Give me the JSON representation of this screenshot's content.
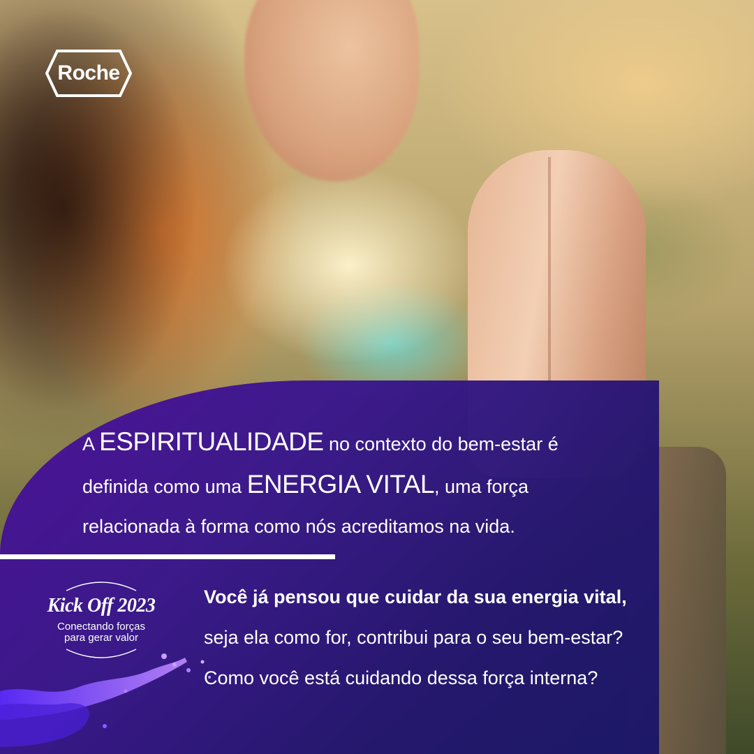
{
  "brand": {
    "logo_text": "Roche"
  },
  "main_text": {
    "part1": "A ",
    "highlight1": "ESPIRITUALIDADE",
    "part2": " no contexto do bem-estar é definida como uma ",
    "highlight2": "ENERGIA VITAL",
    "part3": ", uma força relacionada à forma como nós acreditamos na vida."
  },
  "question": {
    "bold": "Você já pensou que cuidar da sua energia vital,",
    "rest": " seja ela como for, contribui para o seu bem-estar? Como você está cuidando dessa força interna?"
  },
  "kickoff": {
    "title": "Kick Off 2023",
    "subtitle_line1": "Conectando forças",
    "subtitle_line2": "para gerar valor"
  },
  "colors": {
    "panel_start": "#4b0f9a",
    "panel_end": "#1b1668",
    "text": "#ffffff",
    "splash": "#7a3cff"
  },
  "icons": [
    "roche-hexagon-logo",
    "water-splash-decoration"
  ]
}
